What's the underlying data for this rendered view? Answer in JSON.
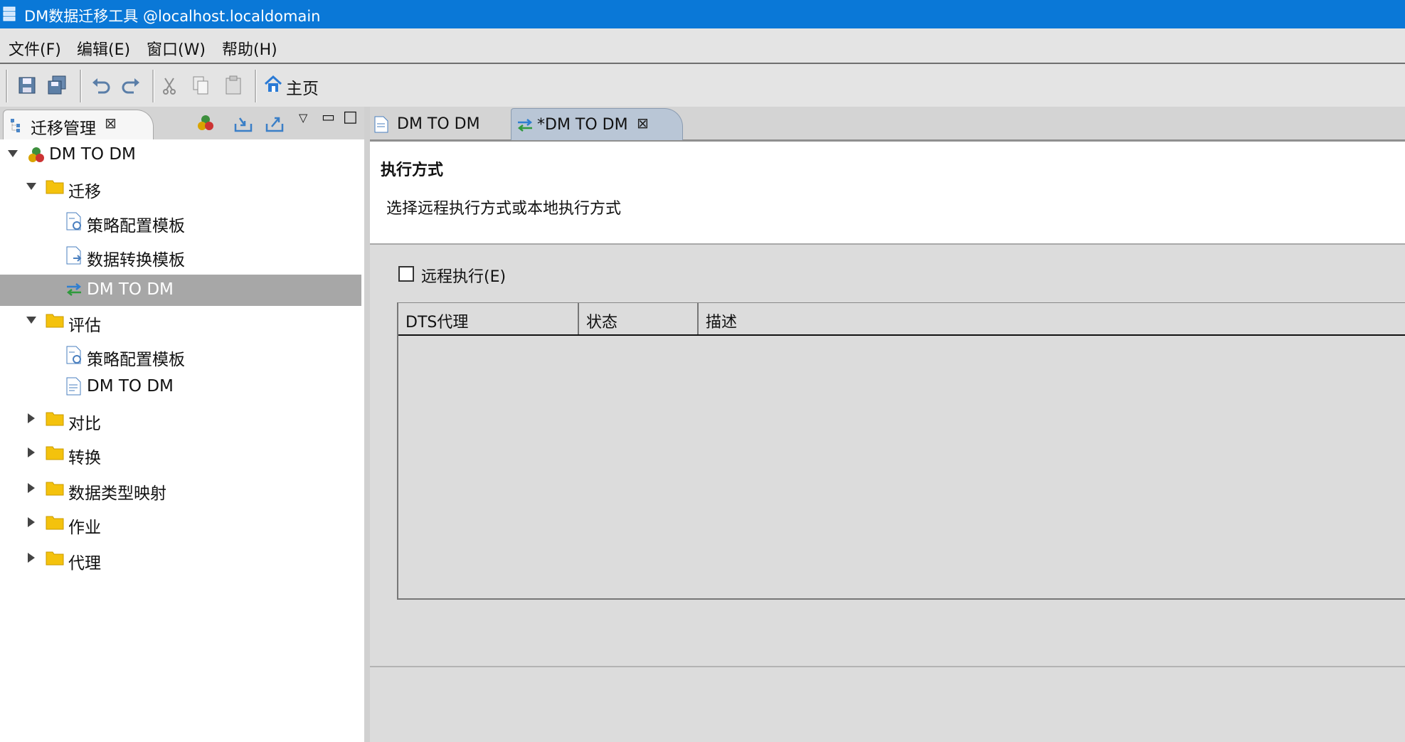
{
  "window": {
    "title": "DM数据迁移工具 @localhost.localdomain"
  },
  "menu": [
    "文件(F)",
    "编辑(E)",
    "窗口(W)",
    "帮助(H)"
  ],
  "toolbar": {
    "home_label": "主页"
  },
  "left_view": {
    "tab_label": "迁移管理",
    "tree": [
      {
        "label": "DM TO DM",
        "level": 0,
        "expanded": true,
        "icon": "project-icon"
      },
      {
        "label": "迁移",
        "level": 1,
        "expanded": true,
        "icon": "folder-icon"
      },
      {
        "label": "策略配置模板",
        "level": 2,
        "icon": "gear-file-icon"
      },
      {
        "label": "数据转换模板",
        "level": 2,
        "icon": "transform-file-icon"
      },
      {
        "label": "DM TO DM",
        "level": 2,
        "icon": "migrate-icon",
        "selected": true
      },
      {
        "label": "评估",
        "level": 1,
        "expanded": true,
        "icon": "folder-icon"
      },
      {
        "label": "策略配置模板",
        "level": 2,
        "icon": "gear-file-icon"
      },
      {
        "label": "DM TO DM",
        "level": 2,
        "icon": "doc-icon"
      },
      {
        "label": "对比",
        "level": 1,
        "expanded": false,
        "icon": "folder-icon"
      },
      {
        "label": "转换",
        "level": 1,
        "expanded": false,
        "icon": "folder-icon"
      },
      {
        "label": "数据类型映射",
        "level": 1,
        "expanded": false,
        "icon": "folder-icon"
      },
      {
        "label": "作业",
        "level": 1,
        "expanded": false,
        "icon": "folder-icon"
      },
      {
        "label": "代理",
        "level": 1,
        "expanded": false,
        "icon": "folder-icon"
      }
    ]
  },
  "editor": {
    "tabs": [
      {
        "label": "DM TO DM",
        "active": false
      },
      {
        "label": "*DM TO DM",
        "active": true
      }
    ],
    "section_title": "执行方式",
    "section_desc": "选择远程执行方式或本地执行方式",
    "remote_checkbox_label": "远程执行(E)",
    "remote_checked": false,
    "table_headers": [
      "DTS代理",
      "状态",
      "描述"
    ]
  },
  "colors": {
    "titlebar": "#0a78d7",
    "selection": "#a7a7a7",
    "folder": "#f4c20d"
  }
}
